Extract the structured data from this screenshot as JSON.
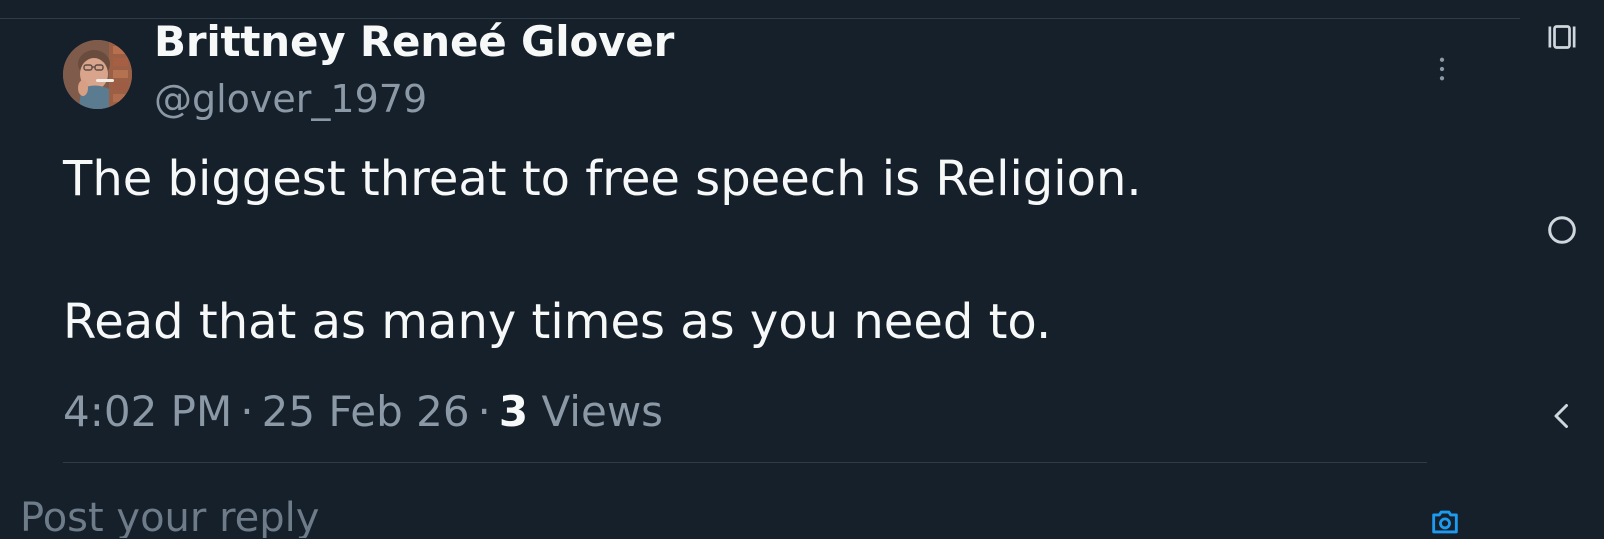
{
  "tweet": {
    "display_name": "Brittney Reneé Glover",
    "handle": "@glover_1979",
    "text_lines": [
      "The biggest threat to free speech is Religion.",
      "Read that as many times as you need to."
    ],
    "time": "4:02 PM",
    "date": "25 Feb 26",
    "views_count": "3",
    "views_label": "Views",
    "separator": "·"
  },
  "reply": {
    "placeholder": "Post your reply"
  },
  "icons": {
    "avatar": "avatar-image",
    "more": "more-vertical-icon",
    "media": "media-icon",
    "recent": "recent-apps-icon",
    "home": "home-icon",
    "back": "back-icon"
  },
  "colors": {
    "background": "#15202b",
    "primary_text": "#f7f9f9",
    "secondary_text": "#8b98a5",
    "divider": "#2f3b47",
    "accent": "#1d9bf0"
  }
}
